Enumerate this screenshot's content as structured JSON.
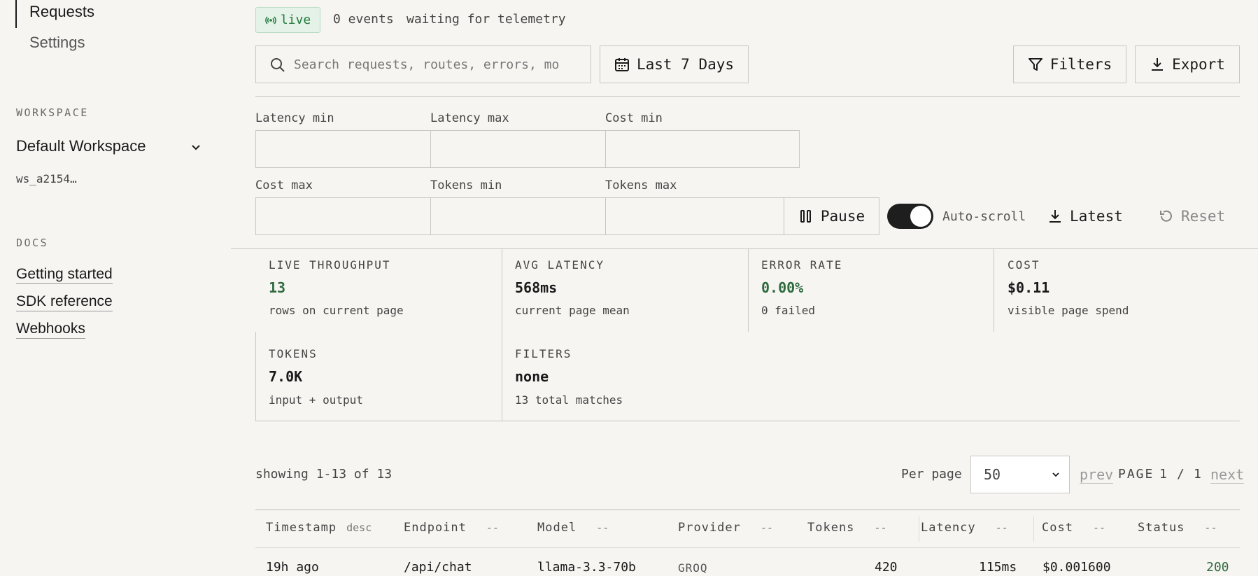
{
  "sidebar": {
    "active_item": "Requests",
    "items": [
      "Settings"
    ],
    "workspace_heading": "WORKSPACE",
    "workspace_name": "Default Workspace",
    "workspace_id": "ws_a2154…",
    "docs_heading": "DOCS",
    "docs_links": [
      "Getting started",
      "SDK reference",
      "Webhooks"
    ]
  },
  "topbar": {
    "live_label": "live",
    "events": "0 events",
    "status": "waiting for telemetry"
  },
  "toolbar": {
    "search_placeholder": "Search requests, routes, errors, models",
    "date_range": "Last 7 Days",
    "filters_label": "Filters",
    "export_label": "Export"
  },
  "filters": {
    "latency_min": "Latency min",
    "latency_max": "Latency max",
    "cost_min": "Cost min",
    "cost_max": "Cost max",
    "tokens_min": "Tokens min",
    "tokens_max": "Tokens max",
    "pause_label": "Pause",
    "autoscroll_label": "Auto-scroll",
    "autoscroll_on": true,
    "latest_label": "Latest",
    "reset_label": "Reset"
  },
  "stats": [
    {
      "label": "LIVE THROUGHPUT",
      "value": "13",
      "sub": "rows on current page",
      "color": "#2f6b3f"
    },
    {
      "label": "AVG LATENCY",
      "value": "568ms",
      "sub": "current page mean",
      "color": "#1a1a1a"
    },
    {
      "label": "ERROR RATE",
      "value": "0.00%",
      "sub": "0 failed",
      "color": "#2f6b3f"
    },
    {
      "label": "COST",
      "value": "$0.11",
      "sub": "visible page spend",
      "color": "#1a1a1a"
    },
    {
      "label": "TOKENS",
      "value": "7.0K",
      "sub": "input + output",
      "color": "#1a1a1a"
    },
    {
      "label": "FILTERS",
      "value": "none",
      "sub": "13 total matches",
      "color": "#1a1a1a"
    }
  ],
  "pagination": {
    "showing": "showing 1-13 of 13",
    "per_page_label": "Per page",
    "per_page_value": "50",
    "prev": "prev",
    "page_label": "PAGE",
    "page_current": "1",
    "page_sep": "/",
    "page_total": "1",
    "next": "next"
  },
  "table": {
    "columns": [
      {
        "label": "Timestamp",
        "sort": "desc"
      },
      {
        "label": "Endpoint",
        "sort": "--"
      },
      {
        "label": "Model",
        "sort": "--"
      },
      {
        "label": "Provider",
        "sort": "--"
      },
      {
        "label": "Tokens",
        "sort": "--"
      },
      {
        "label": "Latency",
        "sort": "--"
      },
      {
        "label": "Cost",
        "sort": "--"
      },
      {
        "label": "Status",
        "sort": "--"
      }
    ],
    "rows": [
      {
        "timestamp": "19h ago",
        "endpoint": "/api/chat",
        "model": "llama-3.3-70b",
        "provider": "GROQ",
        "tokens": "420",
        "latency": "115ms",
        "cost": "$0.001600",
        "status": "200"
      }
    ],
    "status_color": "#2f6b3f"
  }
}
